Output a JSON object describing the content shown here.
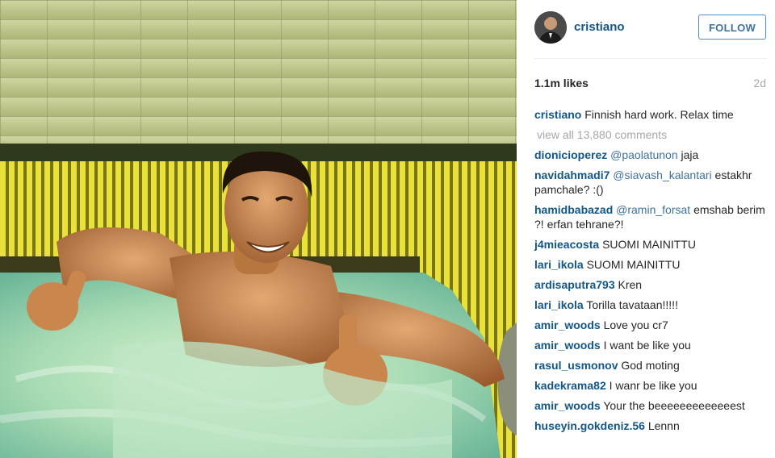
{
  "post": {
    "username": "cristiano",
    "follow_label": "FOLLOW",
    "likes": "1.1m likes",
    "age": "2d"
  },
  "caption": {
    "user": "cristiano",
    "text": "Finnish hard work. Relax time"
  },
  "view_all": "view all 13,880 comments",
  "comments": [
    {
      "user": "dionicioperez",
      "mention": "@paolatunon",
      "text": "jaja"
    },
    {
      "user": "navidahmadi7",
      "mention": "@siavash_kalantari",
      "text": "estakhr pamchale? :()"
    },
    {
      "user": "hamidbabazad",
      "mention": "@ramin_forsat",
      "text": "emshab berim ?! erfan tehrane?!"
    },
    {
      "user": "j4mieacosta",
      "mention": "",
      "text": "SUOMI MAINITTU"
    },
    {
      "user": "lari_ikola",
      "mention": "",
      "text": "SUOMI MAINITTU"
    },
    {
      "user": "ardisaputra793",
      "mention": "",
      "text": "Kren"
    },
    {
      "user": "lari_ikola",
      "mention": "",
      "text": "Torilla tavataan!!!!!"
    },
    {
      "user": "amir_woods",
      "mention": "",
      "text": "Love you cr7"
    },
    {
      "user": "amir_woods",
      "mention": "",
      "text": "I want be like you"
    },
    {
      "user": "rasul_usmonov",
      "mention": "",
      "text": "God moting"
    },
    {
      "user": "kadekrama82",
      "mention": "",
      "text": "I wanr be like you"
    },
    {
      "user": "amir_woods",
      "mention": "",
      "text": "Your the beeeeeeeeeeeeest"
    },
    {
      "user": "huseyin.gokdeniz.56",
      "mention": "",
      "text": "Lennn"
    }
  ],
  "colors": {
    "username": "#125688",
    "mention": "#3f729b",
    "muted": "#a5a7aa",
    "follow_border": "#4e8cc2"
  },
  "icons": {
    "avatar": "profile-avatar"
  }
}
